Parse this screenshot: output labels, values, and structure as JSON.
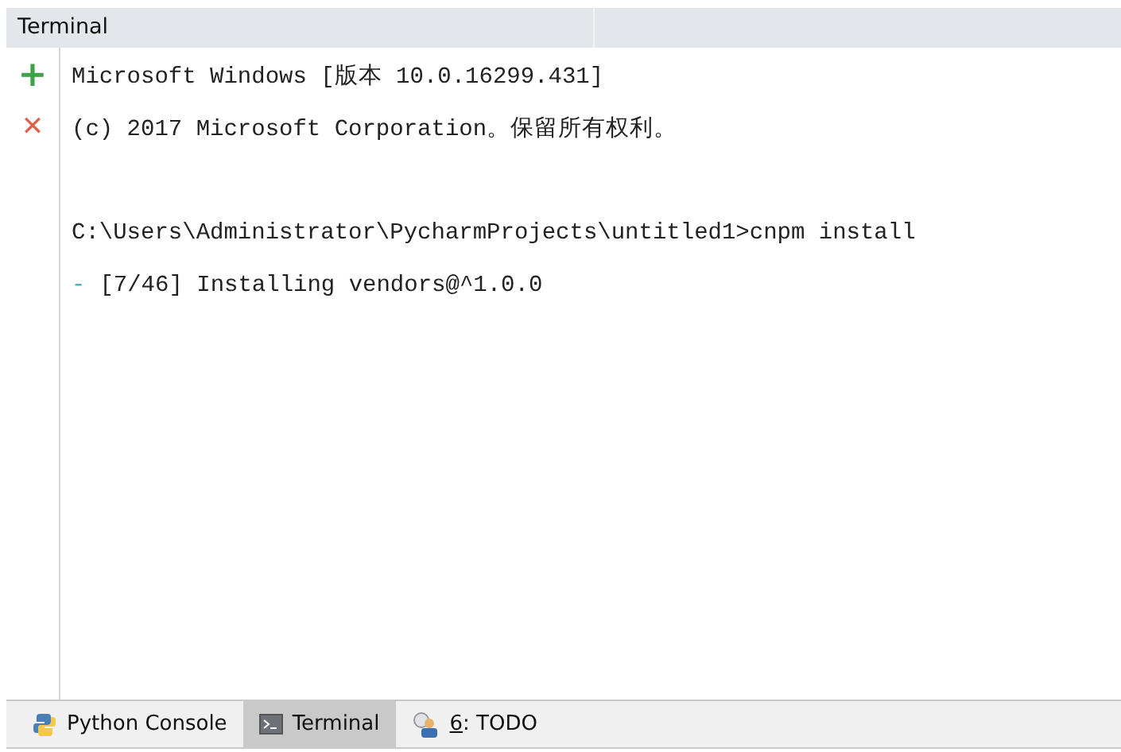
{
  "panel": {
    "title": "Terminal"
  },
  "gutter": [
    {
      "kind": "add",
      "label": "+"
    },
    {
      "kind": "close",
      "label": "✕"
    }
  ],
  "blocks": [
    [
      {
        "kind": "output",
        "text": "Microsoft Windows [版本 10.0.16299.431]"
      },
      {
        "kind": "output",
        "text": "(c) 2017 Microsoft Corporation。保留所有权利。"
      }
    ],
    [
      {
        "kind": "output",
        "text": "C:\\Users\\Administrator\\PycharmProjects\\untitled1>cnpm install"
      },
      {
        "kind": "progress",
        "marker": "-",
        "text": "[7/46] Installing vendors@^1.0.0"
      }
    ]
  ],
  "tool_tabs": [
    {
      "kind": "python",
      "label": "Python Console",
      "selected": false
    },
    {
      "kind": "terminal",
      "label": "Terminal",
      "selected": true
    },
    {
      "kind": "todo",
      "mnemonic": "6",
      "label": ": TODO",
      "selected": false
    }
  ]
}
